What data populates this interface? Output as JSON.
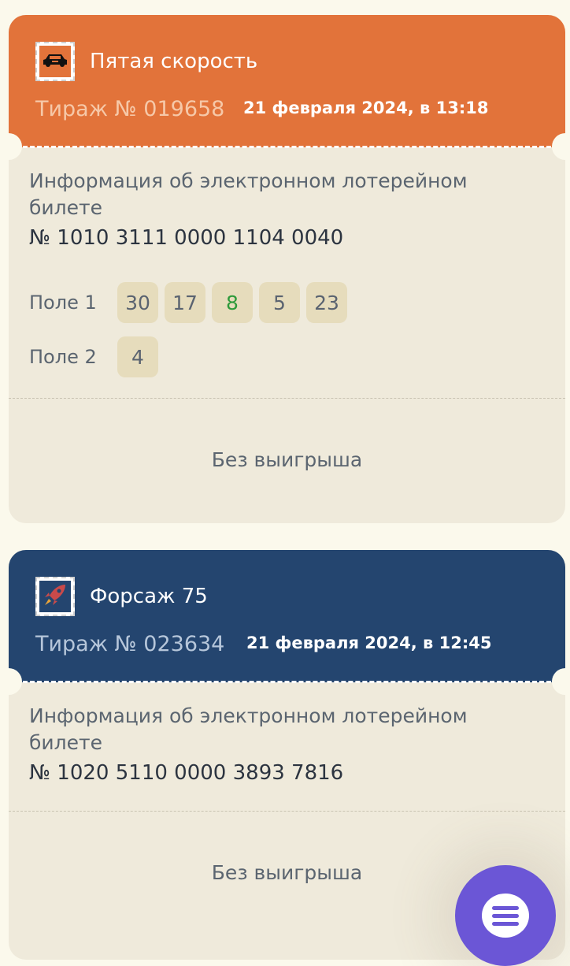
{
  "tickets": [
    {
      "game_title": "Пятая скорость",
      "stamp_icon": "car-icon",
      "header_color": "#e2733a",
      "draw_number": "Тираж № 019658",
      "draw_date": "21 февраля 2024, в 13:18",
      "info_label": "Информация об электронном лотерейном билете",
      "ticket_number": "№ 1010 3111 0000 1104 0040",
      "fields": [
        {
          "label": "Поле 1",
          "numbers": [
            "30",
            "17",
            "8",
            "5",
            "23"
          ],
          "matched": [
            "8"
          ]
        },
        {
          "label": "Поле 2",
          "numbers": [
            "4"
          ],
          "matched": []
        }
      ],
      "result": "Без выигрыша"
    },
    {
      "game_title": "Форсаж 75",
      "stamp_icon": "rocket-icon",
      "header_color": "#24456f",
      "draw_number": "Тираж № 023634",
      "draw_date": "21 февраля 2024, в 12:45",
      "info_label": "Информация об электронном лотерейном билете",
      "ticket_number": "№ 1020 5110 0000 3893 7816",
      "fields": [],
      "result": "Без выигрыша"
    }
  ],
  "chat_button_icon": "chat-icon",
  "colors": {
    "background": "#fbf9ec",
    "card": "#efeadb",
    "ball": "#e6dcbc",
    "match": "#2e9a3a",
    "chat": "#6b56d6"
  }
}
